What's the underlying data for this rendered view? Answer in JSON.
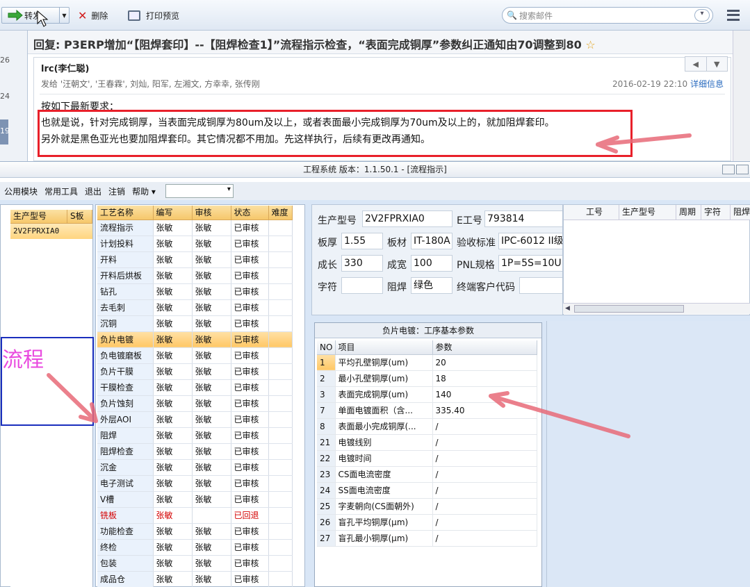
{
  "mail": {
    "toolbar": {
      "forward": "转发",
      "delete": "删除",
      "print_preview": "打印预览",
      "search_placeholder": "搜索邮件"
    },
    "left_strip": [
      "26",
      "24",
      "19"
    ],
    "subject": "回复: P3ERP增加“【阻焊套印】--【阻焊检查1】”流程指示检查，“表面完成铜厚”参数纠正通知由70调整到80",
    "star": "☆",
    "sender": "lrc(李仁聪)",
    "recipients": "发给 '汪朝文', '王春霖', 刘灿, 阳军, 左湘文, 方幸幸, 张传刚",
    "date": "2016-02-19 22:10",
    "detail_link": "详细信息",
    "body": {
      "line1": "按如下最新要求：",
      "line2": "也就是说，针对完成铜厚，当表面完成铜厚为80um及以上，或者表面最小完成铜厚为70um及以上的，就加阻焊套印。",
      "line3": "另外就是黑色亚光也要加阻焊套印。其它情况都不用加。先这样执行，后续有更改再通知。"
    }
  },
  "eng": {
    "title": "工程系统  版本：1.1.50.1 - [流程指示]",
    "menu": [
      "公用模块",
      "常用工具",
      "退出",
      "注销",
      "帮助"
    ],
    "model_grid": {
      "headers": [
        "生产型号",
        "S板"
      ],
      "rows": [
        "2V2FPRXIA0"
      ]
    },
    "annotation_text": "流程",
    "process": {
      "headers": [
        "工艺名称",
        "编写",
        "审核",
        "状态",
        "难度"
      ],
      "rows": [
        [
          "流程指示",
          "张敏",
          "张敏",
          "已审核"
        ],
        [
          "计划投料",
          "张敏",
          "张敏",
          "已审核"
        ],
        [
          "开料",
          "张敏",
          "张敏",
          "已审核"
        ],
        [
          "开料后烘板",
          "张敏",
          "张敏",
          "已审核"
        ],
        [
          "钻孔",
          "张敏",
          "张敏",
          "已审核"
        ],
        [
          "去毛刺",
          "张敏",
          "张敏",
          "已审核"
        ],
        [
          "沉铜",
          "张敏",
          "张敏",
          "已审核"
        ],
        [
          "负片电镀",
          "张敏",
          "张敏",
          "已审核"
        ],
        [
          "负电镀磨板",
          "张敏",
          "张敏",
          "已审核"
        ],
        [
          "负片干膜",
          "张敏",
          "张敏",
          "已审核"
        ],
        [
          "干膜检查",
          "张敏",
          "张敏",
          "已审核"
        ],
        [
          "负片蚀刻",
          "张敏",
          "张敏",
          "已审核"
        ],
        [
          "外层AOI",
          "张敏",
          "张敏",
          "已审核"
        ],
        [
          "阻焊",
          "张敏",
          "张敏",
          "已审核"
        ],
        [
          "阻焊检查",
          "张敏",
          "张敏",
          "已审核"
        ],
        [
          "沉金",
          "张敏",
          "张敏",
          "已审核"
        ],
        [
          "电子测试",
          "张敏",
          "张敏",
          "已审核"
        ],
        [
          "V槽",
          "张敏",
          "张敏",
          "已审核"
        ],
        [
          "铣板",
          "张敏",
          "",
          "已回退"
        ],
        [
          "功能检查",
          "张敏",
          "张敏",
          "已审核"
        ],
        [
          "终检",
          "张敏",
          "张敏",
          "已审核"
        ],
        [
          "包装",
          "张敏",
          "张敏",
          "已审核"
        ],
        [
          "成品仓",
          "张敏",
          "张敏",
          "已审核"
        ]
      ]
    },
    "info": {
      "model_label": "生产型号",
      "model_value": "2V2FPRXIA0",
      "e_label": "E工号",
      "e_value": "793814",
      "thick_label": "板厚",
      "thick_value": "1.55",
      "mat_label": "板材",
      "mat_value": "IT-180A",
      "std_label": "验收标准",
      "std_value": "IPC-6012 II级",
      "len_label": "成长",
      "len_value": "330",
      "wid_label": "成宽",
      "wid_value": "100",
      "pnl_label": "PNL规格",
      "pnl_value": "1P=5S=10U",
      "char_label": "字符",
      "char_value": "",
      "mask_label": "阻焊",
      "mask_value": "绿色",
      "cust_label": "终端客户代码",
      "cust_value": ""
    },
    "right_list_headers": [
      "工号",
      "生产型号",
      "周期",
      "字符",
      "阻焊"
    ],
    "params": {
      "title": "负片电镀：工序基本参数",
      "headers": [
        "NO",
        "项目",
        "参数"
      ],
      "rows": [
        [
          "1",
          "平均孔壁铜厚(um)",
          "20"
        ],
        [
          "2",
          "最小孔壁铜厚(um)",
          "18"
        ],
        [
          "3",
          "表面完成铜厚(um)",
          "140"
        ],
        [
          "7",
          "单面电镀面积（含...",
          "335.40"
        ],
        [
          "8",
          "表面最小完成铜厚(...",
          "/"
        ],
        [
          "21",
          "电镀线别",
          "/"
        ],
        [
          "22",
          "电镀时间",
          "/"
        ],
        [
          "23",
          "CS面电流密度",
          "/"
        ],
        [
          "24",
          "SS面电流密度",
          "/"
        ],
        [
          "25",
          "字麦朝向(CS面朝外)",
          "/"
        ],
        [
          "26",
          "盲孔平均铜厚(μm)",
          "/"
        ],
        [
          "27",
          "盲孔最小铜厚(μm)",
          "/"
        ]
      ]
    }
  },
  "colors": {
    "highlight": "#e8202a",
    "arrow": "#e86a78",
    "annotation": "#e94adf",
    "annotation_border": "#1a2ebd",
    "rejected": "#d40000"
  }
}
